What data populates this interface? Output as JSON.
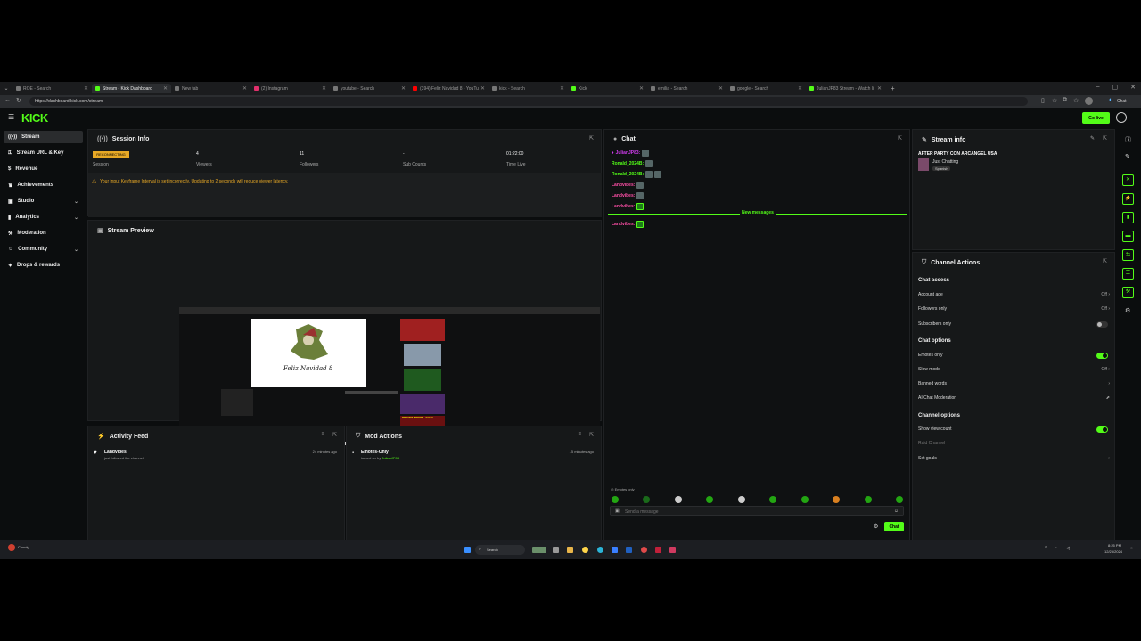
{
  "browser": {
    "tabs": [
      {
        "label": "ROE - Search",
        "icon": "search-icon"
      },
      {
        "label": "Stream - Kick Dashboard",
        "icon": "kick-icon",
        "active": true
      },
      {
        "label": "New tab",
        "icon": "tab-icon"
      },
      {
        "label": "(2) Instagram",
        "icon": "instagram-icon"
      },
      {
        "label": "youtube - Search",
        "icon": "search-icon"
      },
      {
        "label": "(394) Feliz Navidad 8 - YouTu",
        "icon": "youtube-icon"
      },
      {
        "label": "kick - Search",
        "icon": "search-icon"
      },
      {
        "label": "Kick",
        "icon": "kick-icon"
      },
      {
        "label": "emilia - Search",
        "icon": "search-icon"
      },
      {
        "label": "google - Search",
        "icon": "search-icon"
      },
      {
        "label": "JulianJP83 Stream - Watch li",
        "icon": "kick-icon"
      }
    ],
    "url": "https://dashboard.kick.com/stream"
  },
  "app": {
    "logo": "KICK",
    "go_live_label": "Go live"
  },
  "sidebar": {
    "items": [
      {
        "label": "Stream",
        "icon": "stream-icon",
        "active": true
      },
      {
        "label": "Stream URL & Key",
        "icon": "key-icon"
      },
      {
        "label": "Revenue",
        "icon": "dollar-icon"
      },
      {
        "label": "Achievements",
        "icon": "trophy-icon"
      },
      {
        "label": "Studio",
        "icon": "studio-icon",
        "chevron": true
      },
      {
        "label": "Analytics",
        "icon": "analytics-icon",
        "chevron": true
      },
      {
        "label": "Moderation",
        "icon": "moderation-icon"
      },
      {
        "label": "Community",
        "icon": "community-icon",
        "chevron": true
      },
      {
        "label": "Drops & rewards",
        "icon": "gift-icon"
      }
    ]
  },
  "session_info": {
    "title": "Session Info",
    "badge": "RECONNECTING",
    "stats": [
      {
        "value": "",
        "label": "Session"
      },
      {
        "value": "4",
        "label": "Viewers"
      },
      {
        "value": "11",
        "label": "Followers"
      },
      {
        "value": "-",
        "label": "Sub Counts"
      },
      {
        "value": "01:22:00",
        "label": "Time Live"
      }
    ],
    "warning": "Your input Keyframe Interval is set incorrectly. Updating to 2 seconds will reduce viewer latency."
  },
  "stream_preview": {
    "title": "Stream Preview",
    "card_text": "Feliz Navidad 8",
    "card_overlay": "BRYANT MYERS - AGUA"
  },
  "activity_feed": {
    "title": "Activity Feed",
    "items": [
      {
        "user": "Landvibes",
        "text": "just followed the channel",
        "time": "24 minutes ago"
      }
    ]
  },
  "mod_actions": {
    "title": "Mod Actions",
    "items": [
      {
        "title": "Emotes-Only",
        "text_prefix": "turned on by",
        "by": "JulianJP83",
        "time": "15 minutes ago"
      }
    ]
  },
  "chat": {
    "title": "Chat",
    "messages": [
      {
        "user": "JulianJP83:",
        "color": "#d23cf0",
        "emotes": 1
      },
      {
        "user": "Ronald_2024B:",
        "color": "#53fc18",
        "emotes": 1
      },
      {
        "user": "Ronald_2024B:",
        "color": "#53fc18",
        "emotes": 2
      },
      {
        "user": "Landvibes:",
        "color": "#ff4fa7",
        "emotes": 1
      },
      {
        "user": "Landvibes:",
        "color": "#ff4fa7",
        "emotes": 1
      },
      {
        "user": "Landvibes:",
        "color": "#ff4fa7",
        "emotes": 1
      }
    ],
    "new_messages_label": "New messages",
    "after_messages": [
      {
        "user": "Landvibes:",
        "color": "#ff4fa7",
        "emotes": 1
      }
    ],
    "mode_label": "Emotes only",
    "input_placeholder": "Send a message",
    "send_label": "Chat"
  },
  "stream_info": {
    "title": "Stream info",
    "stream_title": "AFTER PARTY CON ARCANGEL USA",
    "category": "Just Chatting",
    "language": "Spanish"
  },
  "channel_actions": {
    "title": "Channel Actions",
    "sections": [
      {
        "heading": "Chat access",
        "rows": [
          {
            "label": "Account age",
            "value": "Off",
            "control": "chevron"
          },
          {
            "label": "Followers only",
            "value": "Off",
            "control": "chevron"
          },
          {
            "label": "Subscribers only",
            "value": "",
            "control": "toggle-off"
          }
        ]
      },
      {
        "heading": "Chat options",
        "rows": [
          {
            "label": "Emotes only",
            "value": "",
            "control": "toggle-on"
          },
          {
            "label": "Slow mode",
            "value": "Off",
            "control": "chevron"
          },
          {
            "label": "Banned words",
            "value": "",
            "control": "chevron"
          },
          {
            "label": "AI Chat Moderation",
            "value": "",
            "control": "external"
          }
        ]
      },
      {
        "heading": "Channel options",
        "rows": [
          {
            "label": "Show view count",
            "value": "",
            "control": "toggle-on"
          },
          {
            "label": "Raid Channel",
            "value": "",
            "control": "none",
            "disabled": true
          },
          {
            "label": "Set goals",
            "value": "",
            "control": "chevron"
          }
        ]
      }
    ]
  },
  "taskbar": {
    "search_placeholder": "Search",
    "weather": "Cloudy",
    "time": "8:25 PM",
    "date": "12/25/2024"
  }
}
